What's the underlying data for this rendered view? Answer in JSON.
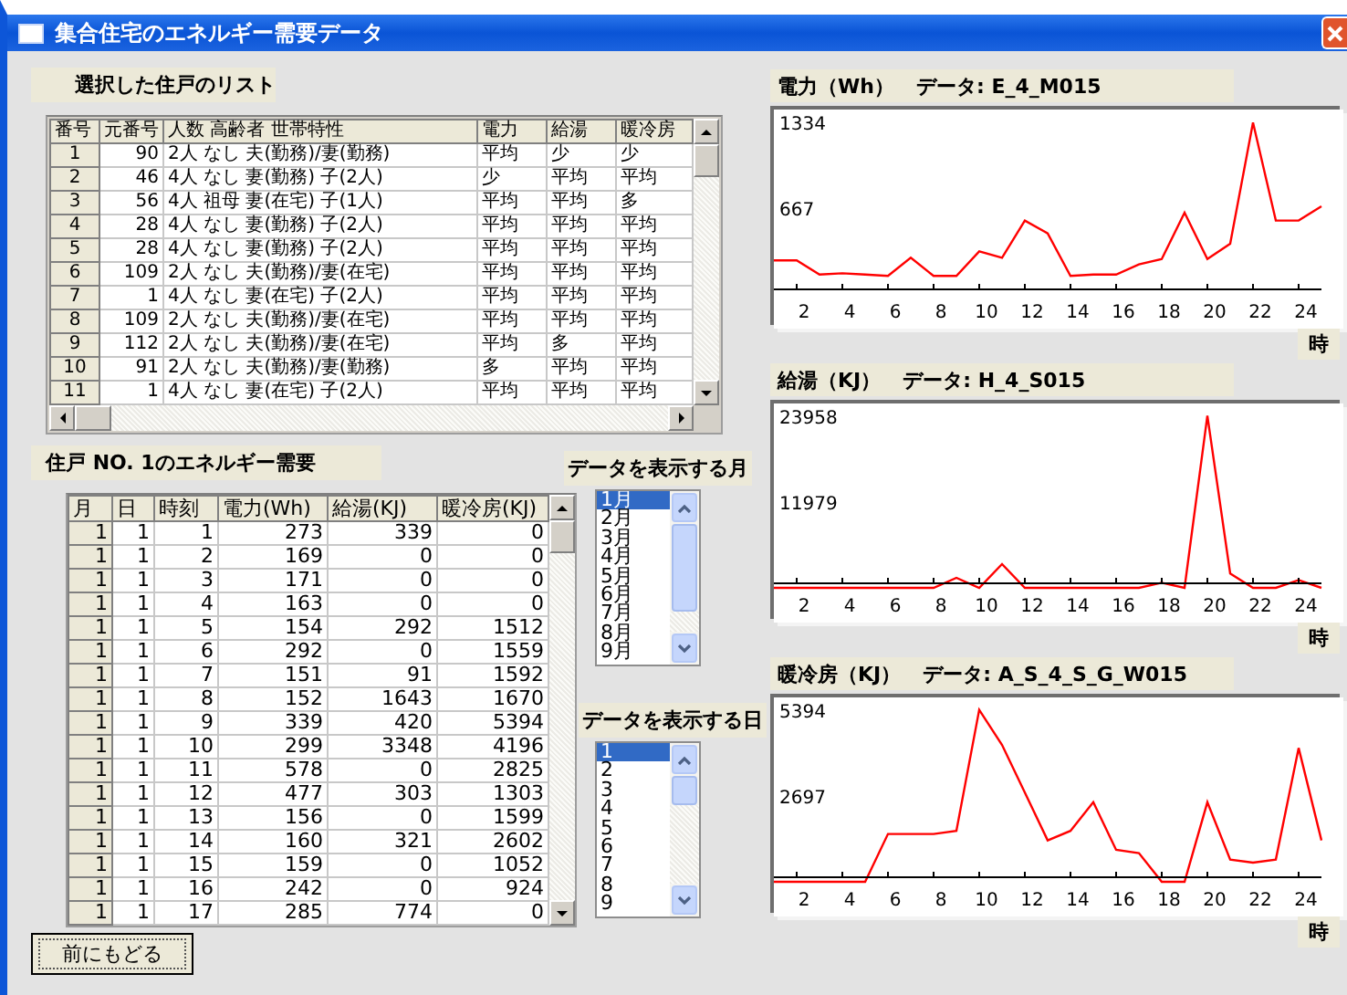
{
  "window": {
    "title": "集合住宅のエネルギー需要データ"
  },
  "household_list": {
    "label": "選択した住戸のリスト",
    "columns": [
      "番号",
      "元番号",
      "人数  高齢者  世帯特性",
      "電力",
      "給湯",
      "暖冷房"
    ],
    "rows": [
      [
        "1",
        "90",
        "2人 なし 夫(勤務)/妻(勤務)",
        "平均",
        "少",
        "少"
      ],
      [
        "2",
        "46",
        "4人 なし 妻(勤務) 子(2人)",
        "少",
        "平均",
        "平均"
      ],
      [
        "3",
        "56",
        "4人 祖母 妻(在宅) 子(1人)",
        "平均",
        "平均",
        "多"
      ],
      [
        "4",
        "28",
        "4人 なし 妻(勤務) 子(2人)",
        "平均",
        "平均",
        "平均"
      ],
      [
        "5",
        "28",
        "4人 なし 妻(勤務) 子(2人)",
        "平均",
        "平均",
        "平均"
      ],
      [
        "6",
        "109",
        "2人 なし 夫(勤務)/妻(在宅)",
        "平均",
        "平均",
        "平均"
      ],
      [
        "7",
        "1",
        "4人 なし 妻(在宅) 子(2人)",
        "平均",
        "平均",
        "平均"
      ],
      [
        "8",
        "109",
        "2人 なし 夫(勤務)/妻(在宅)",
        "平均",
        "平均",
        "平均"
      ],
      [
        "9",
        "112",
        "2人 なし 夫(勤務)/妻(在宅)",
        "平均",
        "多",
        "平均"
      ],
      [
        "10",
        "91",
        "2人 なし 夫(勤務)/妻(勤務)",
        "多",
        "平均",
        "平均"
      ],
      [
        "11",
        "1",
        "4人 なし 妻(在宅) 子(2人)",
        "平均",
        "平均",
        "平均"
      ]
    ]
  },
  "demand_table": {
    "label": "住戸 NO. 1のエネルギー需要",
    "columns": [
      "月",
      "日",
      "時刻",
      "電力(Wh)",
      "給湯(KJ)",
      "暖冷房(KJ)"
    ],
    "rows": [
      [
        "1",
        "1",
        "1",
        "273",
        "339",
        "0"
      ],
      [
        "1",
        "1",
        "2",
        "169",
        "0",
        "0"
      ],
      [
        "1",
        "1",
        "3",
        "171",
        "0",
        "0"
      ],
      [
        "1",
        "1",
        "4",
        "163",
        "0",
        "0"
      ],
      [
        "1",
        "1",
        "5",
        "154",
        "292",
        "1512"
      ],
      [
        "1",
        "1",
        "6",
        "292",
        "0",
        "1559"
      ],
      [
        "1",
        "1",
        "7",
        "151",
        "91",
        "1592"
      ],
      [
        "1",
        "1",
        "8",
        "152",
        "1643",
        "1670"
      ],
      [
        "1",
        "1",
        "9",
        "339",
        "420",
        "5394"
      ],
      [
        "1",
        "1",
        "10",
        "299",
        "3348",
        "4196"
      ],
      [
        "1",
        "1",
        "11",
        "578",
        "0",
        "2825"
      ],
      [
        "1",
        "1",
        "12",
        "477",
        "303",
        "1303"
      ],
      [
        "1",
        "1",
        "13",
        "156",
        "0",
        "1599"
      ],
      [
        "1",
        "1",
        "14",
        "160",
        "321",
        "2602"
      ],
      [
        "1",
        "1",
        "15",
        "159",
        "0",
        "1052"
      ],
      [
        "1",
        "1",
        "16",
        "242",
        "0",
        "924"
      ],
      [
        "1",
        "1",
        "17",
        "285",
        "774",
        "0"
      ]
    ]
  },
  "back_button": "前にもどる",
  "month_picker": {
    "label": "データを表示する月",
    "items": [
      {
        "label": "1月",
        "selected": true
      },
      {
        "label": "2月",
        "selected": false
      },
      {
        "label": "3月",
        "selected": false
      },
      {
        "label": "4月",
        "selected": false
      },
      {
        "label": "5月",
        "selected": false
      },
      {
        "label": "6月",
        "selected": false
      },
      {
        "label": "7月",
        "selected": false
      },
      {
        "label": "8月",
        "selected": false
      },
      {
        "label": "9月",
        "selected": false
      }
    ]
  },
  "day_picker": {
    "label": "データを表示する日",
    "items": [
      {
        "label": "1",
        "selected": true
      },
      {
        "label": "2",
        "selected": false
      },
      {
        "label": "3",
        "selected": false
      },
      {
        "label": "4",
        "selected": false
      },
      {
        "label": "5",
        "selected": false
      },
      {
        "label": "6",
        "selected": false
      },
      {
        "label": "7",
        "selected": false
      },
      {
        "label": "8",
        "selected": false
      },
      {
        "label": "9",
        "selected": false
      }
    ]
  },
  "charts": [
    {
      "dataset": "データ: E_4_M015",
      "chart_data": {
        "type": "line",
        "title": "電力（Wh）",
        "xlabel": "時",
        "x": [
          1,
          2,
          3,
          4,
          5,
          6,
          7,
          8,
          9,
          10,
          11,
          12,
          13,
          14,
          15,
          16,
          17,
          18,
          19,
          20,
          21,
          22,
          23,
          24,
          25
        ],
        "xticks": [
          2,
          4,
          6,
          8,
          10,
          12,
          14,
          16,
          18,
          20,
          22,
          24
        ],
        "xlim": [
          1,
          25
        ],
        "yticks": [
          667,
          1334
        ],
        "ylim": [
          0,
          1431
        ],
        "series": [
          {
            "color": "#ff0000",
            "values": [
              260,
              260,
              150,
              160,
              150,
              140,
              280,
              140,
              140,
              330,
              280,
              570,
              470,
              140,
              150,
              150,
              230,
              270,
              630,
              270,
              390,
              1330,
              570,
              570,
              680
            ]
          }
        ]
      }
    },
    {
      "dataset": "データ: H_4_S015",
      "chart_data": {
        "type": "line",
        "title": "給湯（KJ）",
        "xlabel": "時",
        "x": [
          1,
          2,
          3,
          4,
          5,
          6,
          7,
          8,
          9,
          10,
          11,
          12,
          13,
          14,
          15,
          16,
          17,
          18,
          19,
          20,
          21,
          22,
          23,
          24,
          25
        ],
        "xticks": [
          2,
          4,
          6,
          8,
          10,
          12,
          14,
          16,
          18,
          20,
          22,
          24
        ],
        "xlim": [
          1,
          25
        ],
        "yticks": [
          11979,
          23958
        ],
        "ylim": [
          0,
          25705
        ],
        "series": [
          {
            "color": "#ff0000",
            "values": [
              0,
              0,
              0,
              0,
              0,
              0,
              0,
              0,
              1400,
              0,
              3300,
              0,
              0,
              0,
              0,
              0,
              0,
              700,
              0,
              24000,
              2000,
              0,
              0,
              1100,
              0
            ]
          }
        ]
      }
    },
    {
      "dataset": "データ: A_S_4_S_G_W015",
      "chart_data": {
        "type": "line",
        "title": "暖冷房（KJ）",
        "xlabel": "時",
        "x": [
          1,
          2,
          3,
          4,
          5,
          6,
          7,
          8,
          9,
          10,
          11,
          12,
          13,
          14,
          15,
          16,
          17,
          18,
          19,
          20,
          21,
          22,
          23,
          24,
          25
        ],
        "xticks": [
          2,
          4,
          6,
          8,
          10,
          12,
          14,
          16,
          18,
          20,
          22,
          24
        ],
        "xlim": [
          1,
          25
        ],
        "yticks": [
          2697,
          5394
        ],
        "ylim": [
          0,
          5787
        ],
        "series": [
          {
            "color": "#ff0000",
            "values": [
              0,
              0,
              0,
              0,
              0,
              1500,
              1500,
              1500,
              1600,
              5400,
              4300,
              2800,
              1300,
              1600,
              2500,
              1000,
              900,
              0,
              0,
              2500,
              700,
              600,
              700,
              4200,
              1300
            ]
          }
        ]
      }
    }
  ]
}
